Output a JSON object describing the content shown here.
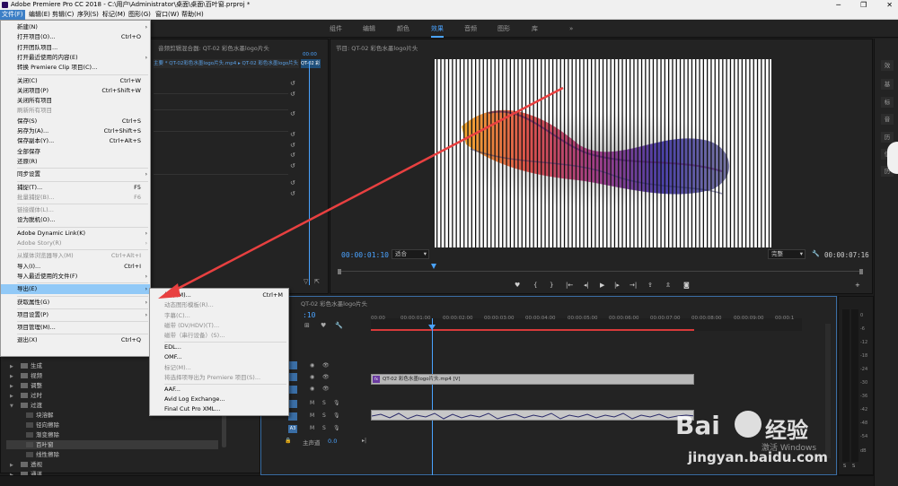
{
  "window": {
    "title": "Adobe Premiere Pro CC 2018 - C:\\用户\\Administrator\\桌面\\桌面\\百叶窗.prproj *",
    "min_icon": "minimize-icon",
    "restore_icon": "restore-icon",
    "close_icon": "close-icon"
  },
  "menubar": [
    {
      "label": "文件(F)",
      "active": true
    },
    {
      "label": "编辑(E)"
    },
    {
      "label": "剪辑(C)"
    },
    {
      "label": "序列(S)"
    },
    {
      "label": "标记(M)"
    },
    {
      "label": "图形(G)"
    },
    {
      "label": "窗口(W)"
    },
    {
      "label": "帮助(H)"
    }
  ],
  "workspaces": {
    "items": [
      "组件",
      "编辑",
      "颜色",
      "效果",
      "音频",
      "图形",
      "库"
    ],
    "active": "效果",
    "more": "»"
  },
  "file_menu": [
    {
      "label": "新建(N)",
      "arrow": true
    },
    {
      "label": "打开项目(O)...",
      "shortcut": "Ctrl+O"
    },
    {
      "label": "打开团队项目..."
    },
    {
      "label": "打开最近使用的内容(E)",
      "arrow": true
    },
    {
      "label": "转换 Premiere Clip 项目(C)..."
    },
    {
      "sep": true
    },
    {
      "label": "关闭(C)",
      "shortcut": "Ctrl+W"
    },
    {
      "label": "关闭项目(P)",
      "shortcut": "Ctrl+Shift+W"
    },
    {
      "label": "关闭所有项目"
    },
    {
      "label": "刷新所有项目",
      "disabled": true
    },
    {
      "label": "保存(S)",
      "shortcut": "Ctrl+S"
    },
    {
      "label": "另存为(A)...",
      "shortcut": "Ctrl+Shift+S"
    },
    {
      "label": "保存副本(Y)...",
      "shortcut": "Ctrl+Alt+S"
    },
    {
      "label": "全部保存"
    },
    {
      "label": "还原(R)"
    },
    {
      "sep": true
    },
    {
      "label": "同步设置",
      "arrow": true
    },
    {
      "sep": true
    },
    {
      "label": "捕捉(T)...",
      "shortcut": "F5"
    },
    {
      "label": "批量捕捉(B)...",
      "shortcut": "F6",
      "disabled": true
    },
    {
      "sep": true
    },
    {
      "label": "链接媒体(L)...",
      "disabled": true
    },
    {
      "label": "设为脱机(O)..."
    },
    {
      "sep": true
    },
    {
      "label": "Adobe Dynamic Link(K)",
      "arrow": true
    },
    {
      "label": "Adobe Story(R)",
      "arrow": true,
      "disabled": true
    },
    {
      "sep": true
    },
    {
      "label": "从媒体浏览器导入(M)",
      "shortcut": "Ctrl+Alt+I",
      "disabled": true
    },
    {
      "label": "导入(I)...",
      "shortcut": "Ctrl+I"
    },
    {
      "label": "导入最近使用的文件(F)",
      "arrow": true
    },
    {
      "sep": true
    },
    {
      "label": "导出(E)",
      "arrow": true,
      "highlight": true
    },
    {
      "sep": true
    },
    {
      "label": "获取属性(G)",
      "arrow": true
    },
    {
      "sep": true
    },
    {
      "label": "项目设置(P)",
      "arrow": true
    },
    {
      "sep": true
    },
    {
      "label": "项目管理(M)..."
    },
    {
      "sep": true
    },
    {
      "label": "退出(X)",
      "shortcut": "Ctrl+Q"
    }
  ],
  "export_submenu": [
    {
      "label": "媒体(M)...",
      "shortcut": "Ctrl+M"
    },
    {
      "label": "动态图形模板(R)...",
      "disabled": true
    },
    {
      "label": "字幕(C)...",
      "disabled": true
    },
    {
      "label": "磁带 (DV/HDV)(T)...",
      "disabled": true
    },
    {
      "label": "磁带（串行设备）(S)...",
      "disabled": true
    },
    {
      "label": "EDL..."
    },
    {
      "label": "OMF..."
    },
    {
      "label": "标记(M)...",
      "disabled": true
    },
    {
      "label": "将选择项导出为 Premiere 项目(S)...",
      "disabled": true
    },
    {
      "label": "AAF..."
    },
    {
      "label": "Avid Log Exchange..."
    },
    {
      "label": "Final Cut Pro XML..."
    }
  ],
  "source_panel": {
    "header": "音频剪辑混合器: QT-02 彩色水墨logo片头",
    "clip_path": "主要 * QT-02彩色水墨logo片头.mp4 ▸ QT-02 彩色水墨logo片头 * QT-02彩色水墨logo片头.mp4",
    "mini_tab": "QT-02 彩",
    "mini_time": "00:00"
  },
  "effects_tree": [
    {
      "label": "生成",
      "type": "folder"
    },
    {
      "label": "视频",
      "type": "folder"
    },
    {
      "label": "调整",
      "type": "folder"
    },
    {
      "label": "过时",
      "type": "folder"
    },
    {
      "label": "过渡",
      "type": "folder",
      "open": true
    },
    {
      "label": "块溶解",
      "type": "effect",
      "indent": true
    },
    {
      "label": "径向擦除",
      "type": "effect",
      "indent": true
    },
    {
      "label": "渐变擦除",
      "type": "effect",
      "indent": true
    },
    {
      "label": "百叶窗",
      "type": "effect",
      "indent": true,
      "selected": true
    },
    {
      "label": "线性擦除",
      "type": "effect",
      "indent": true
    },
    {
      "label": "透视",
      "type": "folder"
    },
    {
      "label": "通道",
      "type": "folder"
    }
  ],
  "program_monitor": {
    "header": "节目: QT-02 彩色水墨logo片头",
    "timecode": "00:00:01:10",
    "fit": "适合",
    "quality": "完整",
    "duration": "00:00:07:16",
    "wrench_icon": "wrench-icon"
  },
  "timeline": {
    "tab": "QT-02 彩色水墨logo片头",
    "timecode": ":10",
    "ruler": [
      "00:00",
      "00:00:01:00",
      "00:00:02:00",
      "00:00:03:00",
      "00:00:04:00",
      "00:00:05:00",
      "00:00:06:00",
      "00:00:07:00",
      "00:00:08:00",
      "00:00:09:00",
      "00:00:1"
    ],
    "video_clip": "QT-02 彩色水墨logo片头.mp4 [V]",
    "audio_tracks": [
      "A1",
      "A2",
      "A3"
    ],
    "master_label": "主声道",
    "master_value": "0.0",
    "track_toggles": [
      "M",
      "S"
    ]
  },
  "vu_meter": {
    "ticks": [
      "0",
      "-6",
      "-12",
      "-18",
      "-24",
      "-30",
      "-36",
      "-42",
      "-48",
      "-54",
      "dB"
    ],
    "labels": [
      "S",
      "S"
    ]
  },
  "right_tools": [
    "效",
    "基",
    "标",
    "音",
    "历",
    "信",
    "历"
  ],
  "watermark": {
    "brand": "Bai",
    "brand2": "经验",
    "url": "jingyan.baidu.com",
    "activate": "激活 Windows"
  },
  "colors": {
    "accent": "#4aa3ff",
    "menu_highlight": "#91c9f7",
    "playhead": "#4aa3ff",
    "arrow": "#e84040"
  }
}
